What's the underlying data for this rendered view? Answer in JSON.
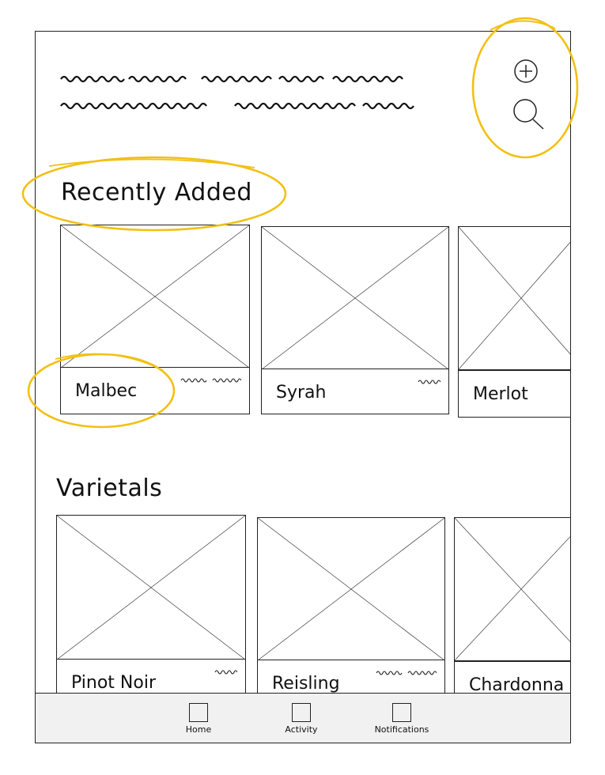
{
  "header": {
    "text_placeholder_lines": 2,
    "actions": [
      {
        "name": "add",
        "icon": "plus-circle-icon"
      },
      {
        "name": "search",
        "icon": "search-icon"
      }
    ]
  },
  "sections": [
    {
      "title": "Recently Added",
      "cards": [
        {
          "label": "Malbec",
          "has_squiggle": true
        },
        {
          "label": "Syrah",
          "has_squiggle": true
        },
        {
          "label": "Merlot",
          "has_squiggle": false
        }
      ]
    },
    {
      "title": "Varietals",
      "cards": [
        {
          "label": "Pinot Noir",
          "has_squiggle": true
        },
        {
          "label": "Reisling",
          "has_squiggle": true
        },
        {
          "label": "Chardonna",
          "has_squiggle": false
        }
      ]
    }
  ],
  "tabbar": {
    "items": [
      {
        "label": "Home",
        "icon": "home-tab-icon"
      },
      {
        "label": "Activity",
        "icon": "activity-tab-icon"
      },
      {
        "label": "Notifications",
        "icon": "notifications-tab-icon"
      }
    ]
  },
  "colors": {
    "annotation": "#f2c014",
    "stroke": "#222222",
    "tabbar_background": "#f1f1f1"
  }
}
